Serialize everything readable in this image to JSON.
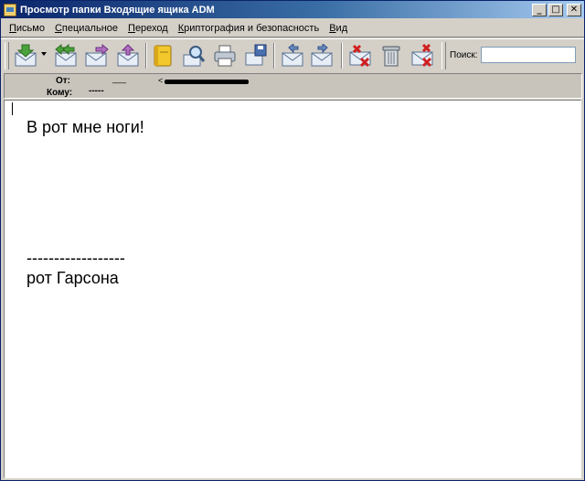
{
  "window": {
    "title": "Просмотр папки Входящие ящика ADM",
    "minimize": "_",
    "maximize": "□",
    "close": "✕"
  },
  "menu": [
    {
      "first": "П",
      "rest": "исьмо"
    },
    {
      "first": "С",
      "rest": "пециальное"
    },
    {
      "first": "П",
      "rest": "ереход"
    },
    {
      "first": "К",
      "rest": "риптография и безопасность"
    },
    {
      "first": "В",
      "rest": "ид"
    }
  ],
  "toolbar": {
    "icons": [
      "envelope-download-icon",
      "envelope-reply-all-icon",
      "envelope-forward-icon",
      "envelope-inbox-icon",
      "address-book-icon",
      "envelope-search-icon",
      "printer-icon",
      "envelope-save-icon",
      "envelope-previous-icon",
      "envelope-next-icon",
      "envelope-delete-icon",
      "trash-icon",
      "envelope-cancel-icon"
    ],
    "search_label": "Поиск:",
    "search_value": ""
  },
  "header": {
    "from_label": "От:",
    "from_name": "___",
    "from_address_open": "<",
    "to_label": "Кому:",
    "to_value": "-----"
  },
  "message": {
    "line1": "В рот мне ноги!",
    "separator": "------------------",
    "signature": "рот Гарсона"
  },
  "colors": {
    "titlebar_start": "#0a246a",
    "titlebar_end": "#a6caf0",
    "chrome": "#d4d0c8",
    "envelope": "#e8eef6",
    "arrow_green": "#4aa23a"
  }
}
